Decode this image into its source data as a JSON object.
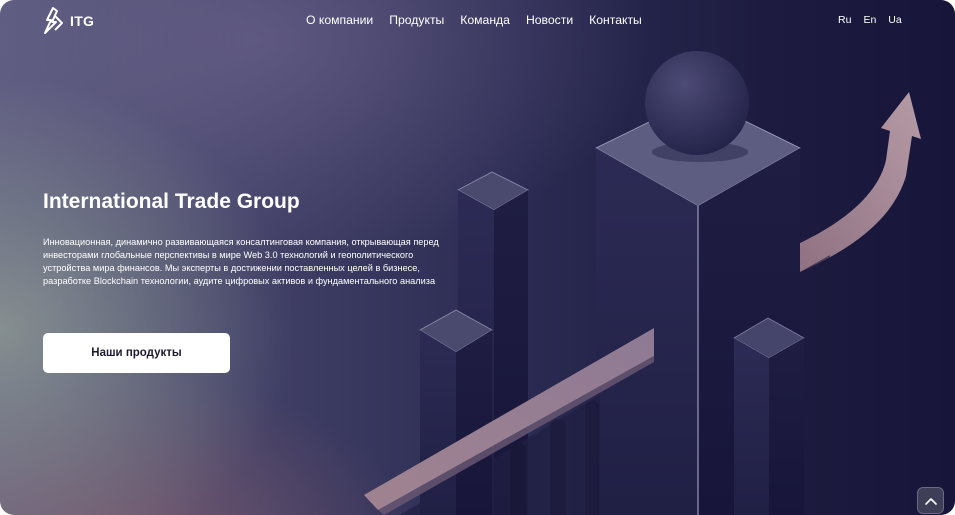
{
  "brand": {
    "name": "ITG",
    "logo_icon": "itg-logo-icon"
  },
  "nav": {
    "items": [
      {
        "label": "О компании"
      },
      {
        "label": "Продукты"
      },
      {
        "label": "Команда"
      },
      {
        "label": "Новости"
      },
      {
        "label": "Контакты"
      }
    ]
  },
  "languages": [
    {
      "label": "Ru"
    },
    {
      "label": "En"
    },
    {
      "label": "Ua"
    }
  ],
  "hero": {
    "title": "International Trade Group",
    "description": "Инновационная, динамично развивающаяся консалтинговая компания, открывающая перед инвесторами глобальные перспективы в мире Web 3.0 технологий и геополитического устройства мира финансов. Мы эксперты в достижении поставленных целей в бизнесе, разработке Blockchain технологии, аудите цифровых активов и фундаментального анализа",
    "cta_label": "Наши продукты"
  },
  "scroll_top": {
    "icon": "chevron-up-icon"
  },
  "colors": {
    "background_dark": "#17163a",
    "background_mid": "#2a2a52",
    "accent_arrow": "#a88e9c",
    "button_bg": "#ffffff",
    "text_primary": "#ffffff"
  }
}
